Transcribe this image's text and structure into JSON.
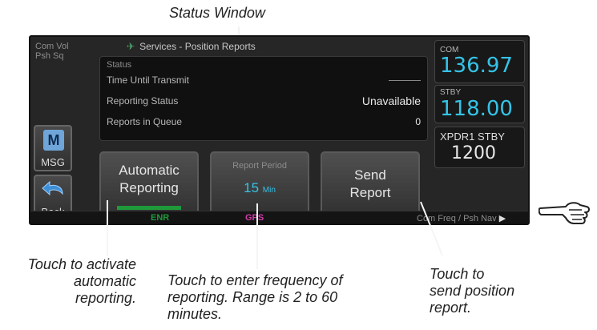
{
  "callouts": {
    "status_window": "Status Window",
    "touch_automatic": [
      "Touch to activate",
      "automatic",
      "reporting."
    ],
    "touch_frequency": [
      "Touch to enter frequency of",
      "reporting. Range is 2 to 60",
      "minutes."
    ],
    "touch_send": [
      "Touch to",
      "send position",
      "report."
    ]
  },
  "left_col": {
    "com_vol": "Com Vol",
    "psh_sq": "Psh Sq",
    "msg_label": "MSG",
    "back_label": "Back"
  },
  "screen": {
    "title": "Services - Position Reports",
    "status": {
      "header": "Status",
      "rows": [
        {
          "label": "Time Until Transmit",
          "value": ""
        },
        {
          "label": "Reporting Status",
          "value": "Unavailable"
        },
        {
          "label": "Reports in Queue",
          "value": "0"
        }
      ]
    },
    "buttons": {
      "automatic_line1": "Automatic",
      "automatic_line2": "Reporting",
      "report_period_label": "Report Period",
      "report_period_value": "15",
      "report_period_unit": "Min",
      "send_line1": "Send",
      "send_line2": "Report"
    }
  },
  "radio": {
    "com_label": "COM",
    "com_value": "136.97",
    "stby_label": "STBY",
    "stby_value": "118.00",
    "xpdr_label": "XPDR1 STBY",
    "xpdr_value": "1200"
  },
  "bottom_bar": {
    "enr": "ENR",
    "gps": "GPS",
    "right": "Com Freq / Psh Nav"
  },
  "colors": {
    "accent_cyan": "#35c3e8",
    "active_green": "#1e9a3a",
    "gps_magenta": "#d23ca8"
  }
}
